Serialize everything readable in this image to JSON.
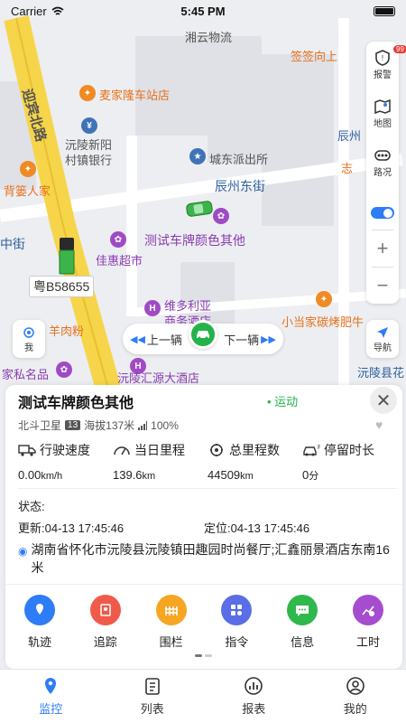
{
  "status_bar": {
    "carrier": "Carrier",
    "time": "5:45 PM"
  },
  "map": {
    "labels": {
      "xiangyun": "湘云物流",
      "qianqian": "签签向上",
      "yingbin": "迎宾北路",
      "maijialong": "麦家隆车站店",
      "yuanling_bank": "沅陵新阳\n村镇银行",
      "police": "城东派出所",
      "chenzhou_east": "辰州东街",
      "beiyao": "背篓人家",
      "test_plate_poi": "测试车牌颜色其他",
      "jiahui": "佳惠超市",
      "plate_1": "粤B58655",
      "weiduo": "维多利亚\n商务酒店",
      "xiaodang": "小当家碳烤肥牛",
      "yangroufen": "羊肉粉",
      "jiasiming": "家私名品",
      "yuanling_hotel": "沅陵汇源大酒店",
      "zhongjie": "中街",
      "chenzhou_side": "辰州",
      "zhi": "志",
      "yuanlingxian": "沅陵县花",
      "jin": "金"
    },
    "tools": {
      "alarm": {
        "label": "报警",
        "badge": "99"
      },
      "layer": {
        "label": "地图"
      },
      "traffic": {
        "label": "路况"
      },
      "zoom_in": "+",
      "zoom_out": "−"
    },
    "me_label": "我",
    "nav_label": "导航",
    "switcher": {
      "prev": "上一辆",
      "next": "下一辆"
    }
  },
  "card": {
    "title": "测试车牌颜色其他",
    "status": "运动",
    "satellite": "北斗卫星",
    "sat_count": "13",
    "altitude": "海拔137米",
    "signal": "100%",
    "stats": [
      {
        "label": "行驶速度",
        "value": "0.00",
        "unit": "km/h"
      },
      {
        "label": "当日里程",
        "value": "139.6",
        "unit": "km"
      },
      {
        "label": "总里程数",
        "value": "44509",
        "unit": "km"
      },
      {
        "label": "停留时长",
        "value": "0",
        "unit": "分"
      }
    ],
    "state_label": "状态:",
    "update_time": "更新:04-13 17:45:46",
    "locate_time": "定位:04-13 17:45:46",
    "address": "湖南省怀化市沅陵县沅陵镇田趣园时尚餐厅;汇鑫丽景酒店东南16米",
    "actions": [
      {
        "label": "轨迹",
        "color": "#2e7cf6",
        "icon": "track-icon"
      },
      {
        "label": "追踪",
        "color": "#f05a4a",
        "icon": "follow-icon"
      },
      {
        "label": "围栏",
        "color": "#f5a623",
        "icon": "fence-icon"
      },
      {
        "label": "指令",
        "color": "#5b6ee8",
        "icon": "command-icon"
      },
      {
        "label": "信息",
        "color": "#2fb84c",
        "icon": "message-icon"
      },
      {
        "label": "工时",
        "color": "#a54ccf",
        "icon": "worktime-icon"
      }
    ]
  },
  "tabs": [
    {
      "label": "监控",
      "icon": "location-icon",
      "active": true
    },
    {
      "label": "列表",
      "icon": "list-icon",
      "active": false
    },
    {
      "label": "报表",
      "icon": "report-icon",
      "active": false
    },
    {
      "label": "我的",
      "icon": "user-icon",
      "active": false
    }
  ]
}
